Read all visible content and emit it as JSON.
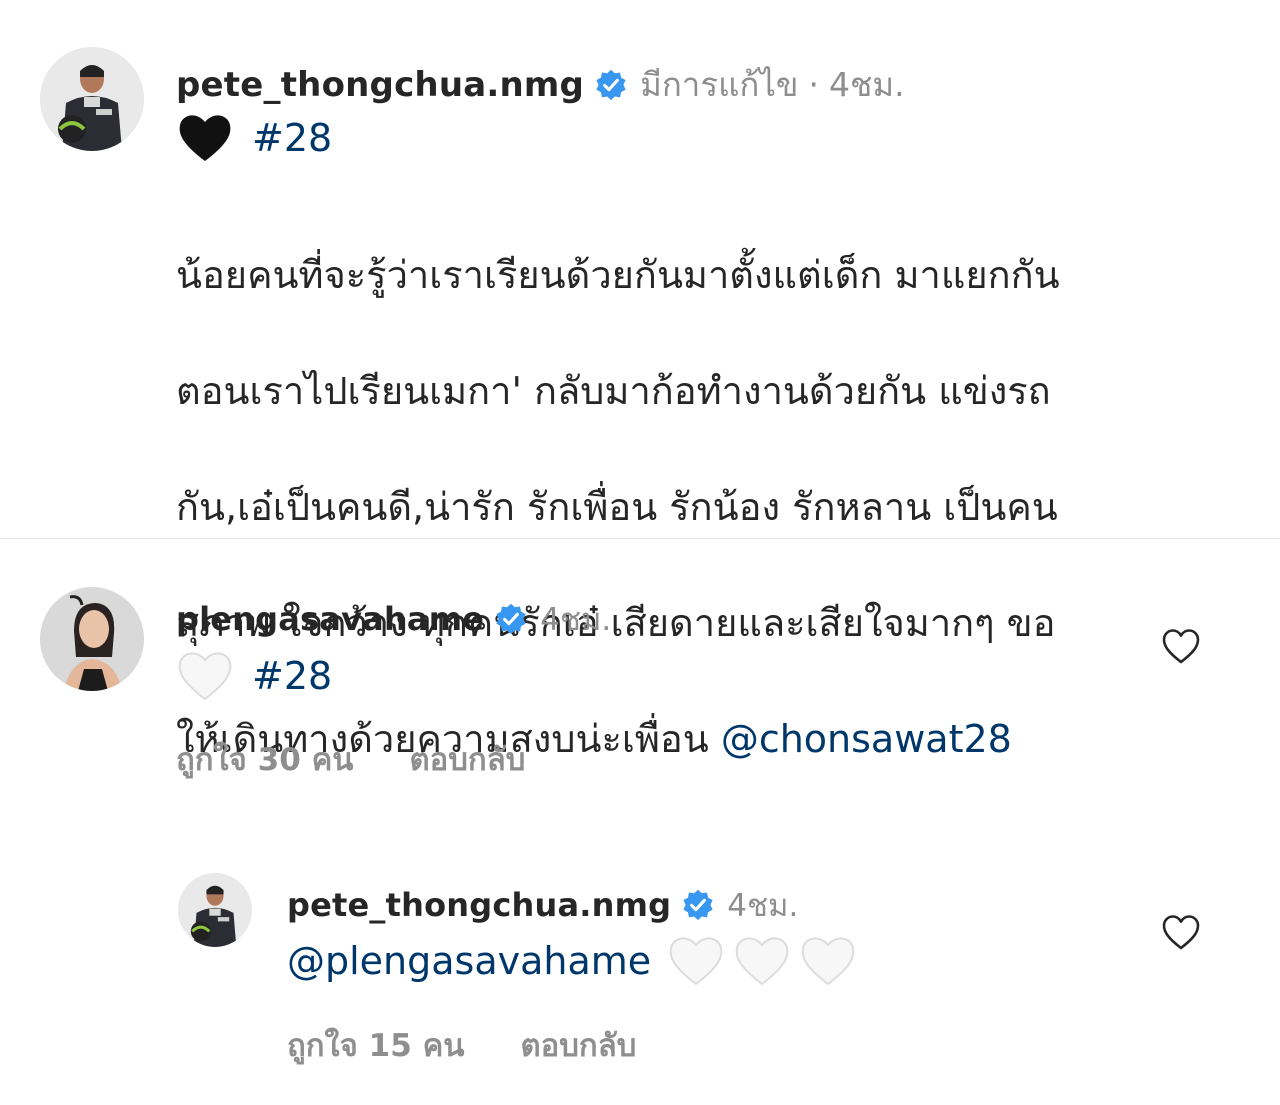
{
  "post": {
    "username": "pete_thongchua.nmg",
    "edited": "มีการแก้ไข",
    "separator": "·",
    "time": "4ชม.",
    "hashtag": "#28",
    "caption_lines": [
      "น้อยคนที่จะรู้ว่าเราเรียนด้วยกันมาตั้งแต่เด็ก มาแยกกัน",
      "ตอนเราไปเรียนเมกา' กลับมาก้อทำงานด้วยกัน แข่งรถ",
      "กัน,เอ๋เป็นคนดี,น่ารัก รักเพื่อน รักน้อง รักหลาน เป็นคน",
      "สุภาพ ใจกว้าง ทุกคนรักเอ๋ เสียดายและเสียใจมากๆ ขอ"
    ],
    "caption_last": "ให้เดินทางด้วยความสงบน่ะเพื่อน",
    "mention": "@chonsawat28"
  },
  "comments": [
    {
      "username": "plengasavahame",
      "time": "4ชม.",
      "hashtag": "#28",
      "likes": "ถูกใจ 30 คน",
      "reply_label": "ตอบกลับ"
    },
    {
      "username": "pete_thongchua.nmg",
      "time": "4ชม.",
      "mention": "@plengasavahame",
      "likes": "ถูกใจ 15 คน",
      "reply_label": "ตอบกลับ"
    }
  ],
  "icons": {
    "verified": "verified-badge-icon",
    "black_heart": "black-heart-emoji",
    "white_heart": "white-heart-emoji",
    "like": "heart-outline-icon"
  },
  "colors": {
    "link": "#00376b",
    "verified": "#3897f0",
    "muted": "#8e8e8e",
    "text": "#262626"
  }
}
